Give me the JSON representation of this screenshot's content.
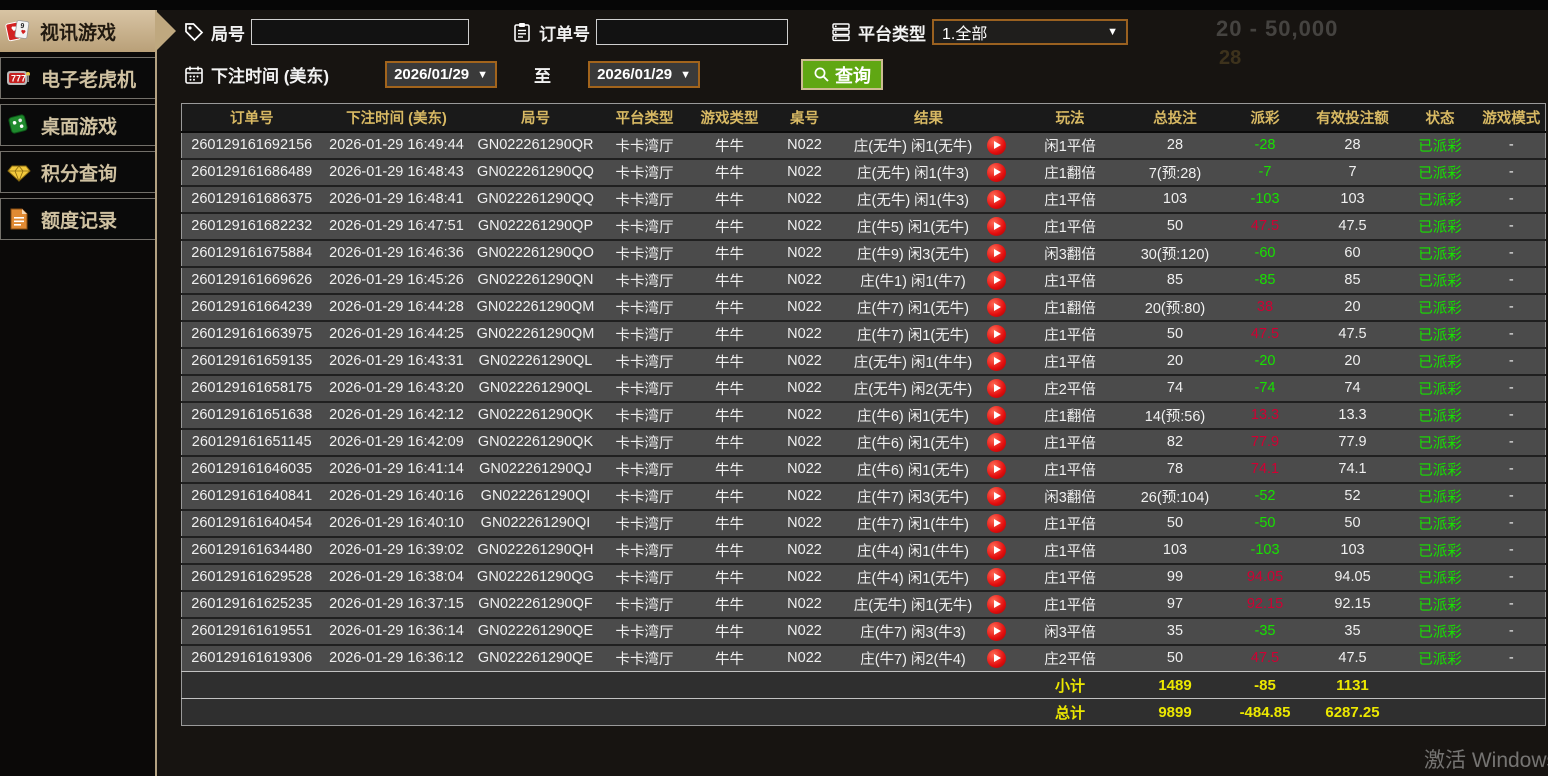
{
  "sidebar": {
    "items": [
      {
        "label": "视讯游戏",
        "icon": "cards-icon",
        "active": true
      },
      {
        "label": "电子老虎机",
        "icon": "slot-777-icon",
        "active": false
      },
      {
        "label": "桌面游戏",
        "icon": "dice-icon",
        "active": false
      },
      {
        "label": "积分查询",
        "icon": "diamond-icon",
        "active": false
      },
      {
        "label": "额度记录",
        "icon": "document-icon",
        "active": false
      }
    ]
  },
  "filters": {
    "round_label": "局号",
    "round_value": "",
    "order_label": "订单号",
    "order_value": "",
    "platform_label": "平台类型",
    "platform_value": "1.全部",
    "bet_time_label": "下注时间 (美东)",
    "date_from": "2026/01/29",
    "to_label": "至",
    "date_to": "2026/01/29",
    "search_label": "查询"
  },
  "ghost_texts": {
    "line1": "20 - 50,000",
    "line2": "28"
  },
  "table": {
    "columns": [
      "订单号",
      "下注时间 (美东)",
      "局号",
      "平台类型",
      "游戏类型",
      "桌号",
      "结果",
      "玩法",
      "总投注",
      "派彩",
      "有效投注额",
      "状态",
      "游戏模式"
    ],
    "rows": [
      {
        "order_id": "260129161692156",
        "bet_time": "2026-01-29 16:49:44",
        "round_id": "GN022261290QR",
        "platform": "卡卡湾厅",
        "game_type": "牛牛",
        "table_no": "N022",
        "result": "庄(无牛) 闲1(无牛)",
        "play": "闲1平倍",
        "total_bet": "28",
        "payout": "-28",
        "payout_color": "green",
        "valid_bet": "28",
        "status": "已派彩",
        "mode": "-"
      },
      {
        "order_id": "260129161686489",
        "bet_time": "2026-01-29 16:48:43",
        "round_id": "GN022261290QQ",
        "platform": "卡卡湾厅",
        "game_type": "牛牛",
        "table_no": "N022",
        "result": "庄(无牛) 闲1(牛3)",
        "play": "庄1翻倍",
        "total_bet": "7(预:28)",
        "payout": "-7",
        "payout_color": "green",
        "valid_bet": "7",
        "status": "已派彩",
        "mode": "-"
      },
      {
        "order_id": "260129161686375",
        "bet_time": "2026-01-29 16:48:41",
        "round_id": "GN022261290QQ",
        "platform": "卡卡湾厅",
        "game_type": "牛牛",
        "table_no": "N022",
        "result": "庄(无牛) 闲1(牛3)",
        "play": "庄1平倍",
        "total_bet": "103",
        "payout": "-103",
        "payout_color": "green",
        "valid_bet": "103",
        "status": "已派彩",
        "mode": "-"
      },
      {
        "order_id": "260129161682232",
        "bet_time": "2026-01-29 16:47:51",
        "round_id": "GN022261290QP",
        "platform": "卡卡湾厅",
        "game_type": "牛牛",
        "table_no": "N022",
        "result": "庄(牛5) 闲1(无牛)",
        "play": "庄1平倍",
        "total_bet": "50",
        "payout": "47.5",
        "payout_color": "red",
        "valid_bet": "47.5",
        "status": "已派彩",
        "mode": "-"
      },
      {
        "order_id": "260129161675884",
        "bet_time": "2026-01-29 16:46:36",
        "round_id": "GN022261290QO",
        "platform": "卡卡湾厅",
        "game_type": "牛牛",
        "table_no": "N022",
        "result": "庄(牛9) 闲3(无牛)",
        "play": "闲3翻倍",
        "total_bet": "30(预:120)",
        "payout": "-60",
        "payout_color": "green",
        "valid_bet": "60",
        "status": "已派彩",
        "mode": "-"
      },
      {
        "order_id": "260129161669626",
        "bet_time": "2026-01-29 16:45:26",
        "round_id": "GN022261290QN",
        "platform": "卡卡湾厅",
        "game_type": "牛牛",
        "table_no": "N022",
        "result": "庄(牛1) 闲1(牛7)",
        "play": "庄1平倍",
        "total_bet": "85",
        "payout": "-85",
        "payout_color": "green",
        "valid_bet": "85",
        "status": "已派彩",
        "mode": "-"
      },
      {
        "order_id": "260129161664239",
        "bet_time": "2026-01-29 16:44:28",
        "round_id": "GN022261290QM",
        "platform": "卡卡湾厅",
        "game_type": "牛牛",
        "table_no": "N022",
        "result": "庄(牛7) 闲1(无牛)",
        "play": "庄1翻倍",
        "total_bet": "20(预:80)",
        "payout": "38",
        "payout_color": "red",
        "valid_bet": "20",
        "status": "已派彩",
        "mode": "-"
      },
      {
        "order_id": "260129161663975",
        "bet_time": "2026-01-29 16:44:25",
        "round_id": "GN022261290QM",
        "platform": "卡卡湾厅",
        "game_type": "牛牛",
        "table_no": "N022",
        "result": "庄(牛7) 闲1(无牛)",
        "play": "庄1平倍",
        "total_bet": "50",
        "payout": "47.5",
        "payout_color": "red",
        "valid_bet": "47.5",
        "status": "已派彩",
        "mode": "-"
      },
      {
        "order_id": "260129161659135",
        "bet_time": "2026-01-29 16:43:31",
        "round_id": "GN022261290QL",
        "platform": "卡卡湾厅",
        "game_type": "牛牛",
        "table_no": "N022",
        "result": "庄(无牛) 闲1(牛牛)",
        "play": "庄1平倍",
        "total_bet": "20",
        "payout": "-20",
        "payout_color": "green",
        "valid_bet": "20",
        "status": "已派彩",
        "mode": "-"
      },
      {
        "order_id": "260129161658175",
        "bet_time": "2026-01-29 16:43:20",
        "round_id": "GN022261290QL",
        "platform": "卡卡湾厅",
        "game_type": "牛牛",
        "table_no": "N022",
        "result": "庄(无牛) 闲2(无牛)",
        "play": "庄2平倍",
        "total_bet": "74",
        "payout": "-74",
        "payout_color": "green",
        "valid_bet": "74",
        "status": "已派彩",
        "mode": "-"
      },
      {
        "order_id": "260129161651638",
        "bet_time": "2026-01-29 16:42:12",
        "round_id": "GN022261290QK",
        "platform": "卡卡湾厅",
        "game_type": "牛牛",
        "table_no": "N022",
        "result": "庄(牛6) 闲1(无牛)",
        "play": "庄1翻倍",
        "total_bet": "14(预:56)",
        "payout": "13.3",
        "payout_color": "red",
        "valid_bet": "13.3",
        "status": "已派彩",
        "mode": "-"
      },
      {
        "order_id": "260129161651145",
        "bet_time": "2026-01-29 16:42:09",
        "round_id": "GN022261290QK",
        "platform": "卡卡湾厅",
        "game_type": "牛牛",
        "table_no": "N022",
        "result": "庄(牛6) 闲1(无牛)",
        "play": "庄1平倍",
        "total_bet": "82",
        "payout": "77.9",
        "payout_color": "red",
        "valid_bet": "77.9",
        "status": "已派彩",
        "mode": "-"
      },
      {
        "order_id": "260129161646035",
        "bet_time": "2026-01-29 16:41:14",
        "round_id": "GN022261290QJ",
        "platform": "卡卡湾厅",
        "game_type": "牛牛",
        "table_no": "N022",
        "result": "庄(牛6) 闲1(无牛)",
        "play": "庄1平倍",
        "total_bet": "78",
        "payout": "74.1",
        "payout_color": "red",
        "valid_bet": "74.1",
        "status": "已派彩",
        "mode": "-"
      },
      {
        "order_id": "260129161640841",
        "bet_time": "2026-01-29 16:40:16",
        "round_id": "GN022261290QI",
        "platform": "卡卡湾厅",
        "game_type": "牛牛",
        "table_no": "N022",
        "result": "庄(牛7) 闲3(无牛)",
        "play": "闲3翻倍",
        "total_bet": "26(预:104)",
        "payout": "-52",
        "payout_color": "green",
        "valid_bet": "52",
        "status": "已派彩",
        "mode": "-"
      },
      {
        "order_id": "260129161640454",
        "bet_time": "2026-01-29 16:40:10",
        "round_id": "GN022261290QI",
        "platform": "卡卡湾厅",
        "game_type": "牛牛",
        "table_no": "N022",
        "result": "庄(牛7) 闲1(牛牛)",
        "play": "庄1平倍",
        "total_bet": "50",
        "payout": "-50",
        "payout_color": "green",
        "valid_bet": "50",
        "status": "已派彩",
        "mode": "-"
      },
      {
        "order_id": "260129161634480",
        "bet_time": "2026-01-29 16:39:02",
        "round_id": "GN022261290QH",
        "platform": "卡卡湾厅",
        "game_type": "牛牛",
        "table_no": "N022",
        "result": "庄(牛4) 闲1(牛牛)",
        "play": "庄1平倍",
        "total_bet": "103",
        "payout": "-103",
        "payout_color": "green",
        "valid_bet": "103",
        "status": "已派彩",
        "mode": "-"
      },
      {
        "order_id": "260129161629528",
        "bet_time": "2026-01-29 16:38:04",
        "round_id": "GN022261290QG",
        "platform": "卡卡湾厅",
        "game_type": "牛牛",
        "table_no": "N022",
        "result": "庄(牛4) 闲1(无牛)",
        "play": "庄1平倍",
        "total_bet": "99",
        "payout": "94.05",
        "payout_color": "red",
        "valid_bet": "94.05",
        "status": "已派彩",
        "mode": "-"
      },
      {
        "order_id": "260129161625235",
        "bet_time": "2026-01-29 16:37:15",
        "round_id": "GN022261290QF",
        "platform": "卡卡湾厅",
        "game_type": "牛牛",
        "table_no": "N022",
        "result": "庄(无牛) 闲1(无牛)",
        "play": "庄1平倍",
        "total_bet": "97",
        "payout": "92.15",
        "payout_color": "red",
        "valid_bet": "92.15",
        "status": "已派彩",
        "mode": "-"
      },
      {
        "order_id": "260129161619551",
        "bet_time": "2026-01-29 16:36:14",
        "round_id": "GN022261290QE",
        "platform": "卡卡湾厅",
        "game_type": "牛牛",
        "table_no": "N022",
        "result": "庄(牛7) 闲3(牛3)",
        "play": "闲3平倍",
        "total_bet": "35",
        "payout": "-35",
        "payout_color": "green",
        "valid_bet": "35",
        "status": "已派彩",
        "mode": "-"
      },
      {
        "order_id": "260129161619306",
        "bet_time": "2026-01-29 16:36:12",
        "round_id": "GN022261290QE",
        "platform": "卡卡湾厅",
        "game_type": "牛牛",
        "table_no": "N022",
        "result": "庄(牛7) 闲2(牛4)",
        "play": "庄2平倍",
        "total_bet": "50",
        "payout": "47.5",
        "payout_color": "red",
        "valid_bet": "47.5",
        "status": "已派彩",
        "mode": "-"
      }
    ],
    "subtotal": {
      "label": "小计",
      "total_bet": "1489",
      "payout": "-85",
      "valid_bet": "1131"
    },
    "grand_total": {
      "label": "总计",
      "total_bet": "9899",
      "payout": "-484.85",
      "valid_bet": "6287.25"
    }
  },
  "watermark": "激活 Windows",
  "colors": {
    "accent_gold": "#d8b963",
    "loss_green": "#17e100",
    "win_red": "#cf0033",
    "total_yellow": "#ece800",
    "button_green": "#60a713",
    "active_tab_tan": "#c8b28f"
  }
}
